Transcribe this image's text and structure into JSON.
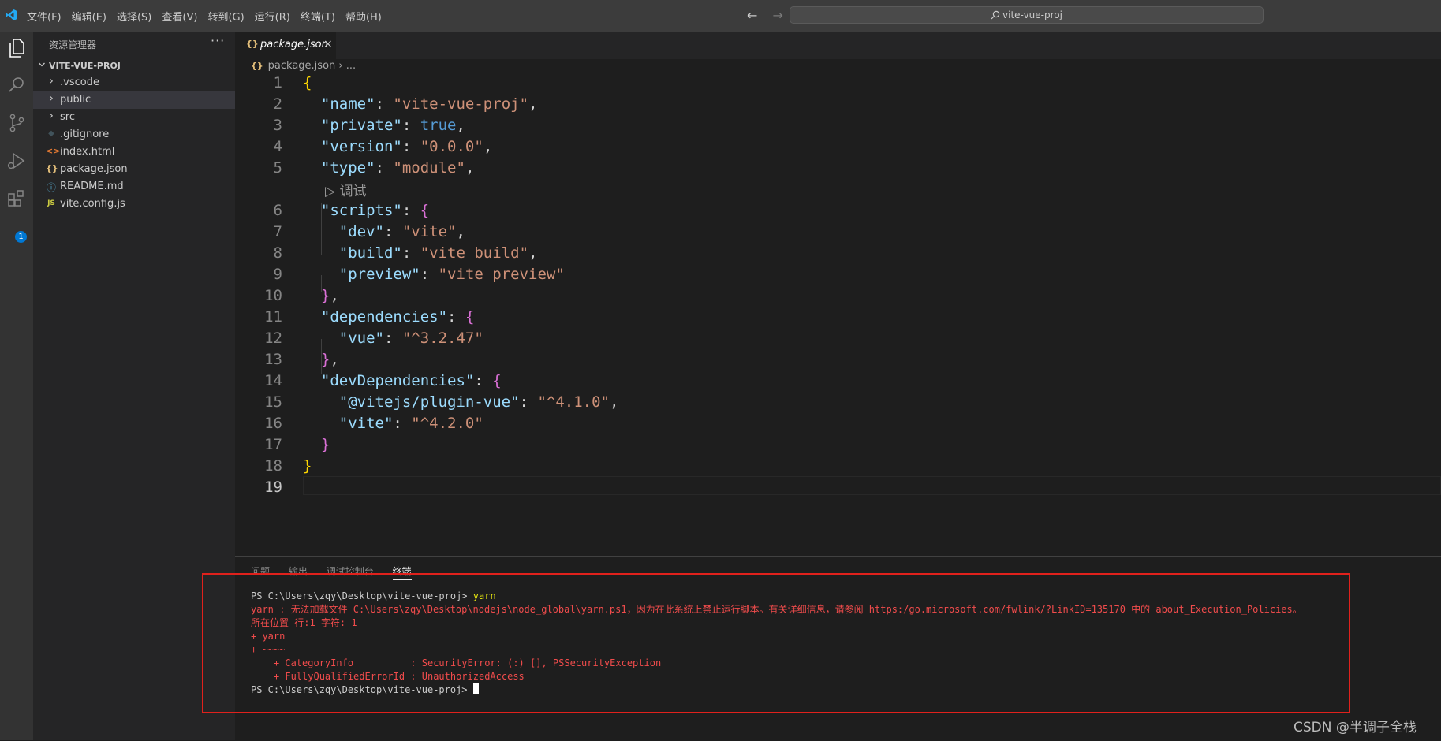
{
  "menu": [
    "文件(F)",
    "编辑(E)",
    "选择(S)",
    "查看(V)",
    "转到(G)",
    "运行(R)",
    "终端(T)",
    "帮助(H)"
  ],
  "nav": {
    "back": "←",
    "forward": "→"
  },
  "command_center": {
    "text": "vite-vue-proj"
  },
  "activity": {
    "extensions_badge": "1"
  },
  "sidebar": {
    "title": "资源管理器",
    "more": "···",
    "root": "VITE-VUE-PROJ",
    "items": [
      {
        "icon": "›",
        "label": ".vscode"
      },
      {
        "icon": "›",
        "label": "public"
      },
      {
        "icon": "›",
        "label": "src"
      },
      {
        "icon": "◆",
        "label": ".gitignore"
      },
      {
        "icon": "<>",
        "label": "index.html"
      },
      {
        "icon": "{}",
        "label": "package.json"
      },
      {
        "icon": "ⓘ",
        "label": "README.md"
      },
      {
        "icon": "JS",
        "label": "vite.config.js"
      }
    ]
  },
  "tab": {
    "icon": "{}",
    "label": "package.json",
    "close": "×"
  },
  "breadcrumb": {
    "icon": "{}",
    "file": "package.json",
    "sep": "›",
    "rest": "..."
  },
  "codelens": "▷ 调试",
  "panel": {
    "tabs": [
      "问题",
      "输出",
      "调试控制台",
      "终端"
    ],
    "prompt": "PS C:\\Users\\zqy\\Desktop\\vite-vue-proj>",
    "command": "yarn",
    "errors": [
      "yarn : 无法加载文件 C:\\Users\\zqy\\Desktop\\nodejs\\node_global\\yarn.ps1，因为在此系统上禁止运行脚本。有关详细信息，请参阅 https:/go.microsoft.com/fwlink/?LinkID=135170 中的 about_Execution_Policies。",
      "所在位置 行:1 字符: 1",
      "+ yarn",
      "+ ~~~~",
      "    + CategoryInfo          : SecurityError: (:) [], PSSecurityException",
      "    + FullyQualifiedErrorId : UnauthorizedAccess"
    ],
    "prompt2": "PS C:\\Users\\zqy\\Desktop\\vite-vue-proj>"
  },
  "watermark": "CSDN @半调子全栈"
}
